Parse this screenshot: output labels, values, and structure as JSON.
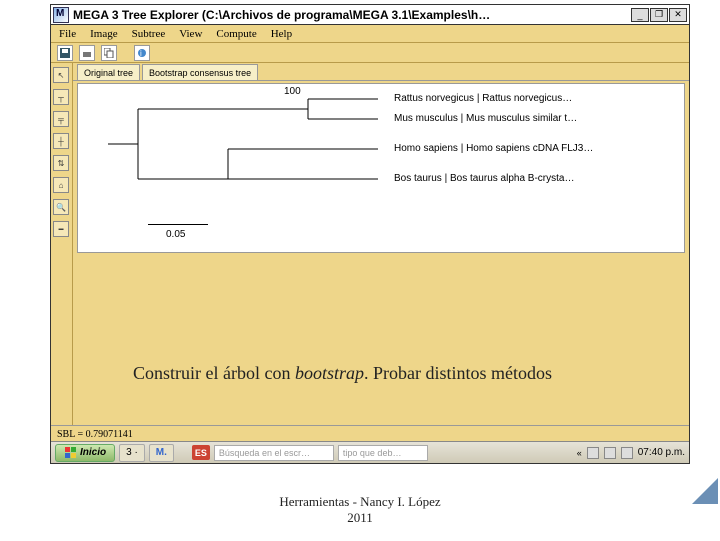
{
  "window": {
    "title": "MEGA 3 Tree Explorer (C:\\Archivos de programa\\MEGA 3.1\\Examples\\h…",
    "menu": [
      "File",
      "Image",
      "Subtree",
      "View",
      "Compute",
      "Help"
    ],
    "tabs": [
      "Original tree",
      "Bootstrap consensus tree"
    ],
    "status": "SBL = 0.79071141"
  },
  "win_ctrl": {
    "min": "_",
    "max": "❐",
    "close": "✕"
  },
  "tree": {
    "bootstrap_root": "100",
    "scale": "0.05",
    "labels": {
      "l1": "Rattus norvegicus | Rattus norvegicus…",
      "l2": "Mus musculus | Mus musculus similar t…",
      "l3": "Homo sapiens | Homo sapiens cDNA FLJ3…",
      "l4": "Bos taurus | Bos taurus alpha B-crysta…"
    }
  },
  "note": {
    "pre": "Construir el árbol con ",
    "em": "bootstrap",
    "post": ". Probar distintos métodos"
  },
  "taskbar": {
    "start": "Inicio",
    "apps": {
      "a1": "3 ·",
      "a2": "M."
    },
    "lang": "ES",
    "search_ph": "Búsqueda en el escr…",
    "search2_ph": "tipo que deb…",
    "expand": "«",
    "clock": "07:40 p.m."
  },
  "footer": {
    "l1": "Herramientas - Nancy I. López",
    "l2": "2011"
  }
}
